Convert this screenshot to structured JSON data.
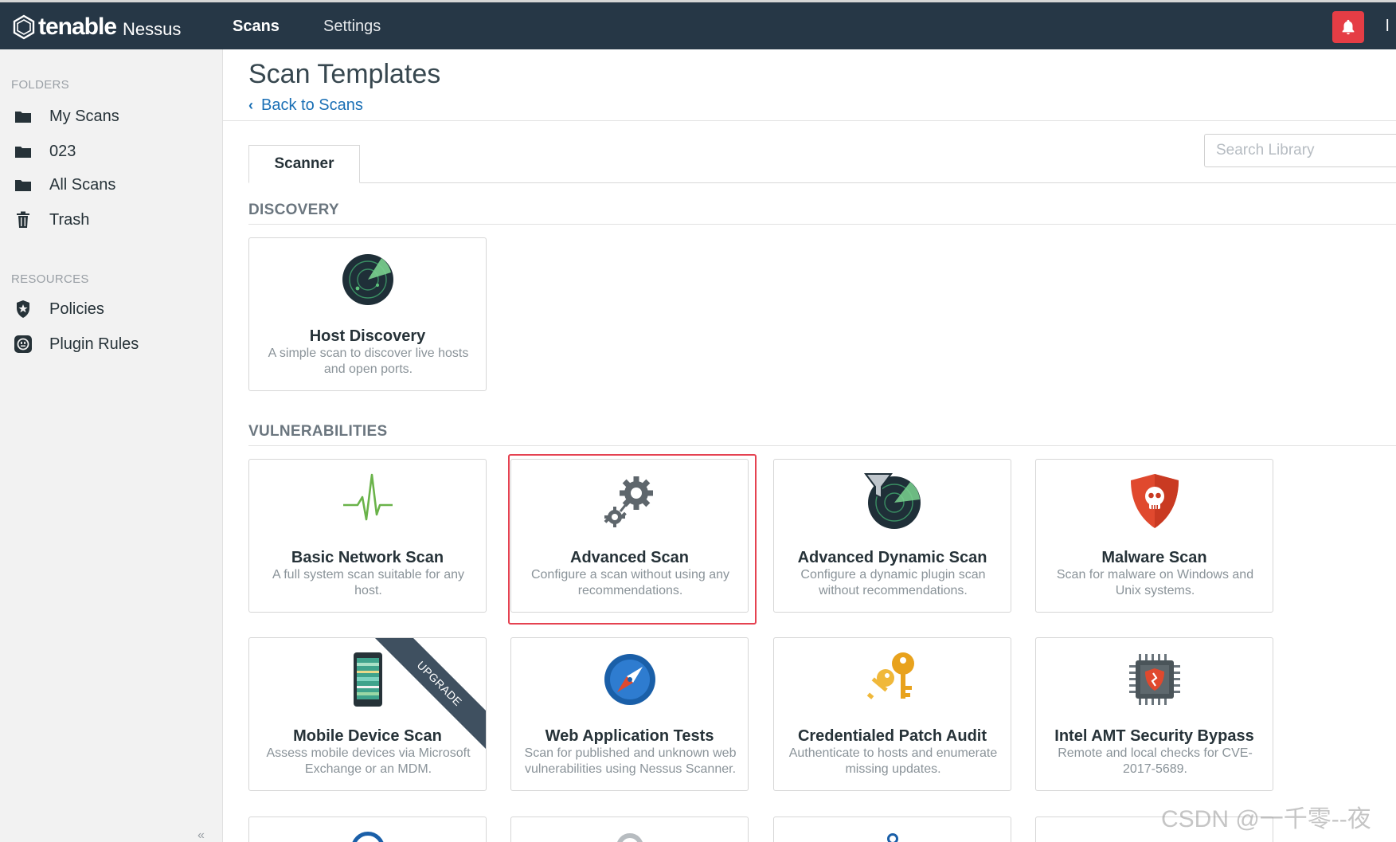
{
  "topbar": {
    "brand": "tenable",
    "product": "Nessus",
    "nav": {
      "scans": "Scans",
      "settings": "Settings"
    },
    "user_initial": "l"
  },
  "sidebar": {
    "folders_heading": "FOLDERS",
    "folders": [
      {
        "label": "My Scans",
        "icon": "folder-icon"
      },
      {
        "label": "023",
        "icon": "folder-icon"
      },
      {
        "label": "All Scans",
        "icon": "folder-icon"
      },
      {
        "label": "Trash",
        "icon": "trash-icon"
      }
    ],
    "resources_heading": "RESOURCES",
    "resources": [
      {
        "label": "Policies",
        "icon": "policy-shield-icon"
      },
      {
        "label": "Plugin Rules",
        "icon": "plugin-rules-icon"
      }
    ],
    "collapse_glyph": "«"
  },
  "main": {
    "title": "Scan Templates",
    "back_link": "Back to Scans",
    "tab": "Scanner",
    "search_placeholder": "Search Library",
    "sections": {
      "discovery": "DISCOVERY",
      "vulnerabilities": "VULNERABILITIES"
    },
    "discovery_cards": [
      {
        "name": "Host Discovery",
        "desc": "A simple scan to discover live hosts and open ports.",
        "icon": "radar-icon"
      }
    ],
    "vuln_cards": [
      {
        "name": "Basic Network Scan",
        "desc": "A full system scan suitable for any host.",
        "icon": "heartbeat-icon"
      },
      {
        "name": "Advanced Scan",
        "desc": "Configure a scan without using any recommendations.",
        "icon": "gears-icon"
      },
      {
        "name": "Advanced Dynamic Scan",
        "desc": "Configure a dynamic plugin scan without recommendations.",
        "icon": "radar-filter-icon"
      },
      {
        "name": "Malware Scan",
        "desc": "Scan for malware on Windows and Unix systems.",
        "icon": "skull-shield-icon"
      },
      {
        "name": "Mobile Device Scan",
        "desc": "Assess mobile devices via Microsoft Exchange or an MDM.",
        "icon": "mobile-icon",
        "badge": "UPGRADE"
      },
      {
        "name": "Web Application Tests",
        "desc": "Scan for published and unknown web vulnerabilities using Nessus Scanner.",
        "icon": "compass-icon"
      },
      {
        "name": "Credentialed Patch Audit",
        "desc": "Authenticate to hosts and enumerate missing updates.",
        "icon": "keys-icon"
      },
      {
        "name": "Intel AMT Security Bypass",
        "desc": "Remote and local checks for CVE-2017-5689.",
        "icon": "chip-icon"
      }
    ]
  },
  "watermark": "CSDN @一千零--夜",
  "colors": {
    "topbar": "#263746",
    "accent_link": "#1a6fb5",
    "alert": "#e53d45",
    "highlight": "#e54251"
  }
}
